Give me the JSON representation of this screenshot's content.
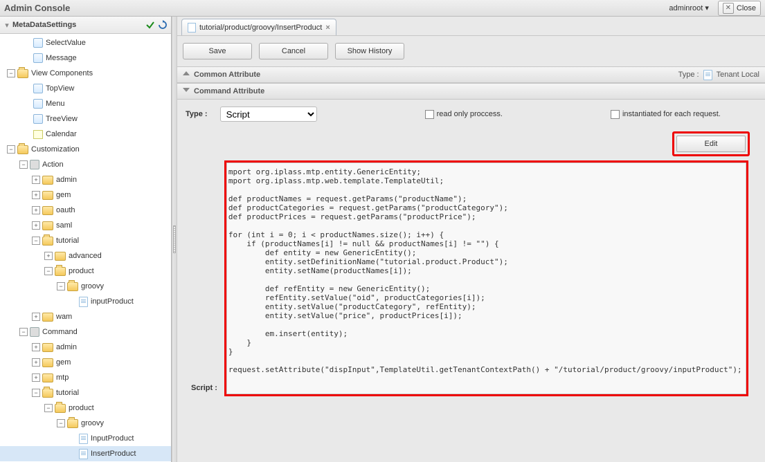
{
  "header": {
    "title": "Admin Console",
    "user_label": "adminroot",
    "close_label": "Close"
  },
  "sidebar": {
    "panel_title": "MetaDataSettings",
    "items": {
      "select_value": "SelectValue",
      "message": "Message",
      "view_components": "View Components",
      "top_view": "TopView",
      "menu": "Menu",
      "tree_view": "TreeView",
      "calendar": "Calendar",
      "customization": "Customization",
      "action": "Action",
      "admin": "admin",
      "gem": "gem",
      "oauth": "oauth",
      "saml": "saml",
      "tutorial": "tutorial",
      "advanced": "advanced",
      "product": "product",
      "groovy": "groovy",
      "input_product": "inputProduct",
      "wam": "wam",
      "command": "Command",
      "cmd_admin": "admin",
      "cmd_gem": "gem",
      "cmd_mtp": "mtp",
      "cmd_tutorial": "tutorial",
      "cmd_product": "product",
      "cmd_groovy": "groovy",
      "cmd_input_product": "InputProduct",
      "cmd_insert_product": "InsertProduct"
    }
  },
  "tab": {
    "label": "tutorial/product/groovy/InsertProduct"
  },
  "buttons": {
    "save": "Save",
    "cancel": "Cancel",
    "history": "Show History",
    "edit": "Edit"
  },
  "sections": {
    "common_attribute": "Common Attribute",
    "command_attribute": "Command Attribute",
    "type_label": "Type :",
    "type_value_label": "Tenant Local"
  },
  "command": {
    "type_label": "Type :",
    "type_value": "Script",
    "readonly_label": "read only proccess.",
    "instantiated_label": "instantiated for each request.",
    "script_label": "Script :"
  },
  "script": "mport org.iplass.mtp.entity.GenericEntity;\nmport org.iplass.mtp.web.template.TemplateUtil;\n\ndef productNames = request.getParams(\"productName\");\ndef productCategories = request.getParams(\"productCategory\");\ndef productPrices = request.getParams(\"productPrice\");\n\nfor (int i = 0; i < productNames.size(); i++) {\n    if (productNames[i] != null && productNames[i] != \"\") {\n        def entity = new GenericEntity();\n        entity.setDefinitionName(\"tutorial.product.Product\");\n        entity.setName(productNames[i]);\n\n        def refEntity = new GenericEntity();\n        refEntity.setValue(\"oid\", productCategories[i]);\n        entity.setValue(\"productCategory\", refEntity);\n        entity.setValue(\"price\", productPrices[i]);\n\n        em.insert(entity);\n    }\n}\n\nrequest.setAttribute(\"dispInput\",TemplateUtil.getTenantContextPath() + \"/tutorial/product/groovy/inputProduct\");"
}
